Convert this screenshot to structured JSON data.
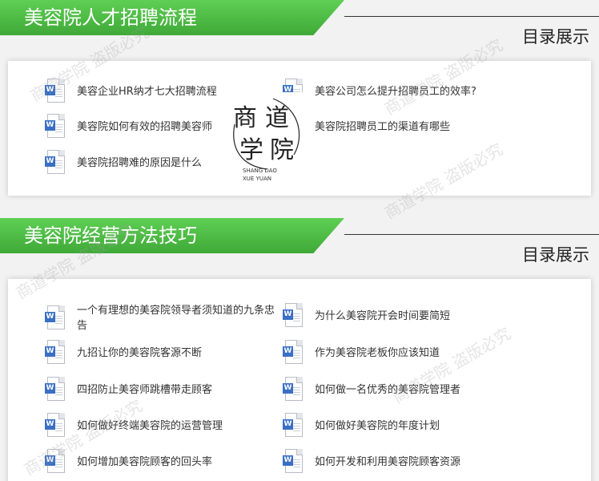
{
  "sections": [
    {
      "title": "美容院人才招聘流程",
      "catalog_label": "目录展示",
      "items": [
        "美容企业HR纳才七大招聘流程",
        "美容公司怎么提升招聘员工的效率?",
        "美容院如何有效的招聘美容师",
        "美容院招聘员工的渠道有哪些",
        "美容院招聘难的原因是什么"
      ]
    },
    {
      "title": "美容院经营方法技巧",
      "catalog_label": "目录展示",
      "items": [
        "一个有理想的美容院领导者须知道的九条忠告",
        "为什么美容院开会时间要简短",
        "九招让你的美容院客源不断",
        "作为美容院老板你应该知道",
        "四招防止美容师跳槽带走顾客",
        "如何做一名优秀的美容院管理者",
        "如何做好终端美容院的运营管理",
        "如何做好美容院的年度计划",
        "如何增加美容院顾客的回头率",
        "如何开发和利用美容院顾客资源"
      ]
    }
  ],
  "stamp": {
    "chars": [
      "商",
      "道",
      "学",
      "院"
    ],
    "pinyin_line1": "SHANG DAO",
    "pinyin_line2": "XUE YUAN"
  },
  "watermark": {
    "text": "商道学院 盗版必究"
  },
  "icon": {
    "name": "word-document-icon",
    "badge": "W",
    "badge_color": "#3a6fc4"
  },
  "colors": {
    "banner_green": "#4cbb44",
    "background": "#f2f2f2"
  }
}
